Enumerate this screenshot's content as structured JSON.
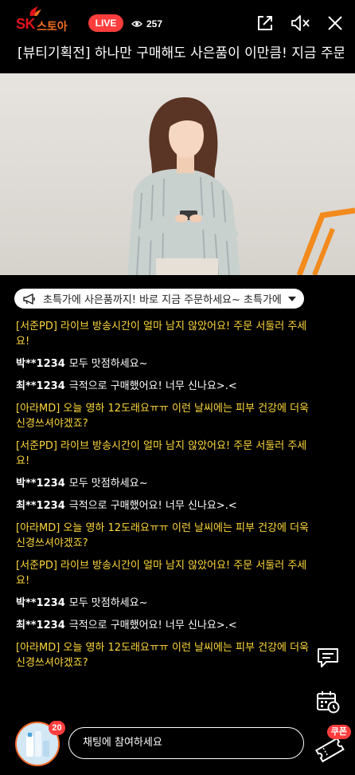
{
  "header": {
    "logo_sk": "SK",
    "logo_store": "스토아",
    "live_label": "LIVE",
    "viewer_count": "257",
    "title": "[뷰티기획전] 하나만 구매해도 사은품이 이만큼! 지금 주문하세요"
  },
  "notice": {
    "text": "초특가에 사은품까지! 바로 지금 주문하세요~ 초특가에 사은품까지!"
  },
  "chat": {
    "messages": [
      {
        "type": "staff",
        "text": "[서준PD] 라이브 방송시간이 얼마 남지 않았어요! 주문 서둘러 주세요!"
      },
      {
        "type": "user",
        "user": "박**1234",
        "text": "모두 맛점하세요~"
      },
      {
        "type": "user",
        "user": "최**1234",
        "text": "극적으로 구매했어요! 너무 신나요>.<"
      },
      {
        "type": "staff",
        "text": "[아라MD] 오늘 영하 12도래요ㅠㅠ 이런 날씨에는 피부 건강에 더욱 신경쓰셔야겠죠?"
      },
      {
        "type": "staff",
        "text": "[서준PD] 라이브 방송시간이 얼마 남지 않았어요! 주문 서둘러 주세요!"
      },
      {
        "type": "user",
        "user": "박**1234",
        "text": "모두 맛점하세요~"
      },
      {
        "type": "user",
        "user": "최**1234",
        "text": "극적으로 구매했어요! 너무 신나요>.<"
      },
      {
        "type": "staff",
        "text": "[아라MD] 오늘 영하 12도래요ㅠㅠ 이런 날씨에는 피부 건강에 더욱 신경쓰셔야겠죠?"
      },
      {
        "type": "staff",
        "text": "[서준PD] 라이브 방송시간이 얼마 남지 않았어요! 주문 서둘러 주세요!"
      },
      {
        "type": "user",
        "user": "박**1234",
        "text": "모두 맛점하세요~"
      },
      {
        "type": "user",
        "user": "최**1234",
        "text": "극적으로 구매했어요! 너무 신나요>.<"
      },
      {
        "type": "staff",
        "text": "[아라MD] 오늘 영하 12도래요ㅠㅠ 이런 날씨에는 피부 건강에 더욱 신경쓰셔야겠죠?"
      }
    ]
  },
  "bottom": {
    "product_count": "20",
    "input_placeholder": "채팅에 참여하세요",
    "coupon_label": "쿠폰"
  },
  "colors": {
    "live_red": "#ff3d3d",
    "staff_yellow": "#ffd83b",
    "brand_orange": "#f36f21"
  },
  "icons": [
    "share-icon",
    "mute-icon",
    "close-icon",
    "megaphone-icon",
    "chat-bubble-icon",
    "calendar-clock-icon",
    "coupon-ticket-icon",
    "eye-icon"
  ]
}
